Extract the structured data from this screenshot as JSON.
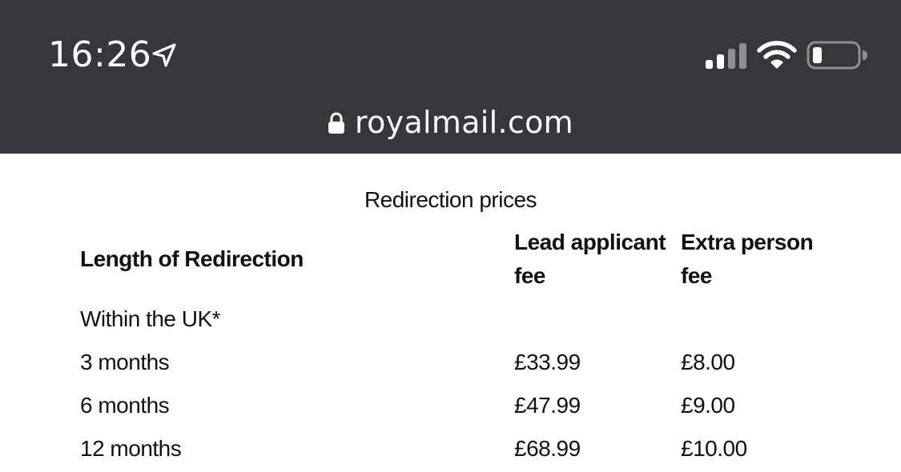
{
  "status_bar": {
    "time": "16:26",
    "icons": [
      "location-arrow-icon",
      "cellular-signal-icon",
      "wifi-icon",
      "battery-icon"
    ]
  },
  "browser": {
    "url": "royalmail.com",
    "lock_icon": "lock-icon"
  },
  "table": {
    "caption": "Redirection prices",
    "headers": {
      "length": "Length of Redirection",
      "lead_line1": "Lead applicant",
      "lead_line2": "fee",
      "extra_line1": "Extra person",
      "extra_line2": "fee"
    },
    "section": "Within the UK*",
    "rows": [
      {
        "length": "3 months",
        "lead": "£33.99",
        "extra": "£8.00"
      },
      {
        "length": "6 months",
        "lead": "£47.99",
        "extra": "£9.00"
      },
      {
        "length": "12 months",
        "lead": "£68.99",
        "extra": "£10.00"
      }
    ]
  },
  "colors": {
    "chrome_background": "#36373b",
    "page_background": "#ffffff",
    "text": "#111111"
  }
}
